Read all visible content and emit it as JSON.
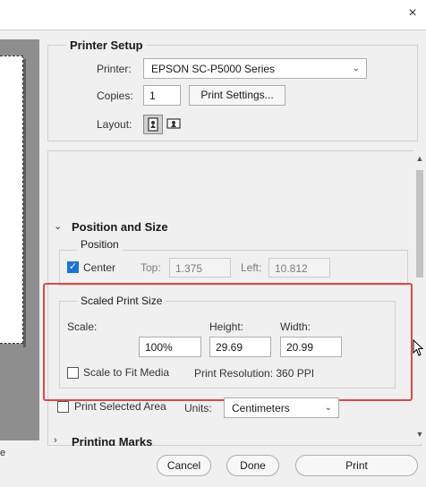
{
  "window": {
    "close_glyph": "×"
  },
  "preview": {
    "bottom_text": "e"
  },
  "printer_setup": {
    "title": "Printer Setup",
    "printer_label": "Printer:",
    "printer_value": "EPSON SC-P5000 Series",
    "copies_label": "Copies:",
    "copies_value": "1",
    "print_settings_button": "Print Settings...",
    "layout_label": "Layout:"
  },
  "position_and_size": {
    "section_title": "Position and Size",
    "position": {
      "title": "Position",
      "center_label": "Center",
      "center_checked": true,
      "top_label": "Top:",
      "top_value": "1.375",
      "left_label": "Left:",
      "left_value": "10.812"
    },
    "scaled_print_size": {
      "title": "Scaled Print Size",
      "scale_label": "Scale:",
      "scale_value": "100%",
      "height_label": "Height:",
      "height_value": "29.69",
      "width_label": "Width:",
      "width_value": "20.99",
      "scale_to_fit_label": "Scale to Fit Media",
      "scale_to_fit_checked": false,
      "resolution_text": "Print Resolution: 360 PPI"
    },
    "print_selected_area_label": "Print Selected Area",
    "units_label": "Units:",
    "units_value": "Centimeters"
  },
  "printing_marks": {
    "section_title": "Printing Marks"
  },
  "footer": {
    "cancel": "Cancel",
    "done": "Done",
    "print": "Print"
  },
  "colors": {
    "highlight": "#e04747",
    "checkbox_accent": "#1e73d8"
  }
}
